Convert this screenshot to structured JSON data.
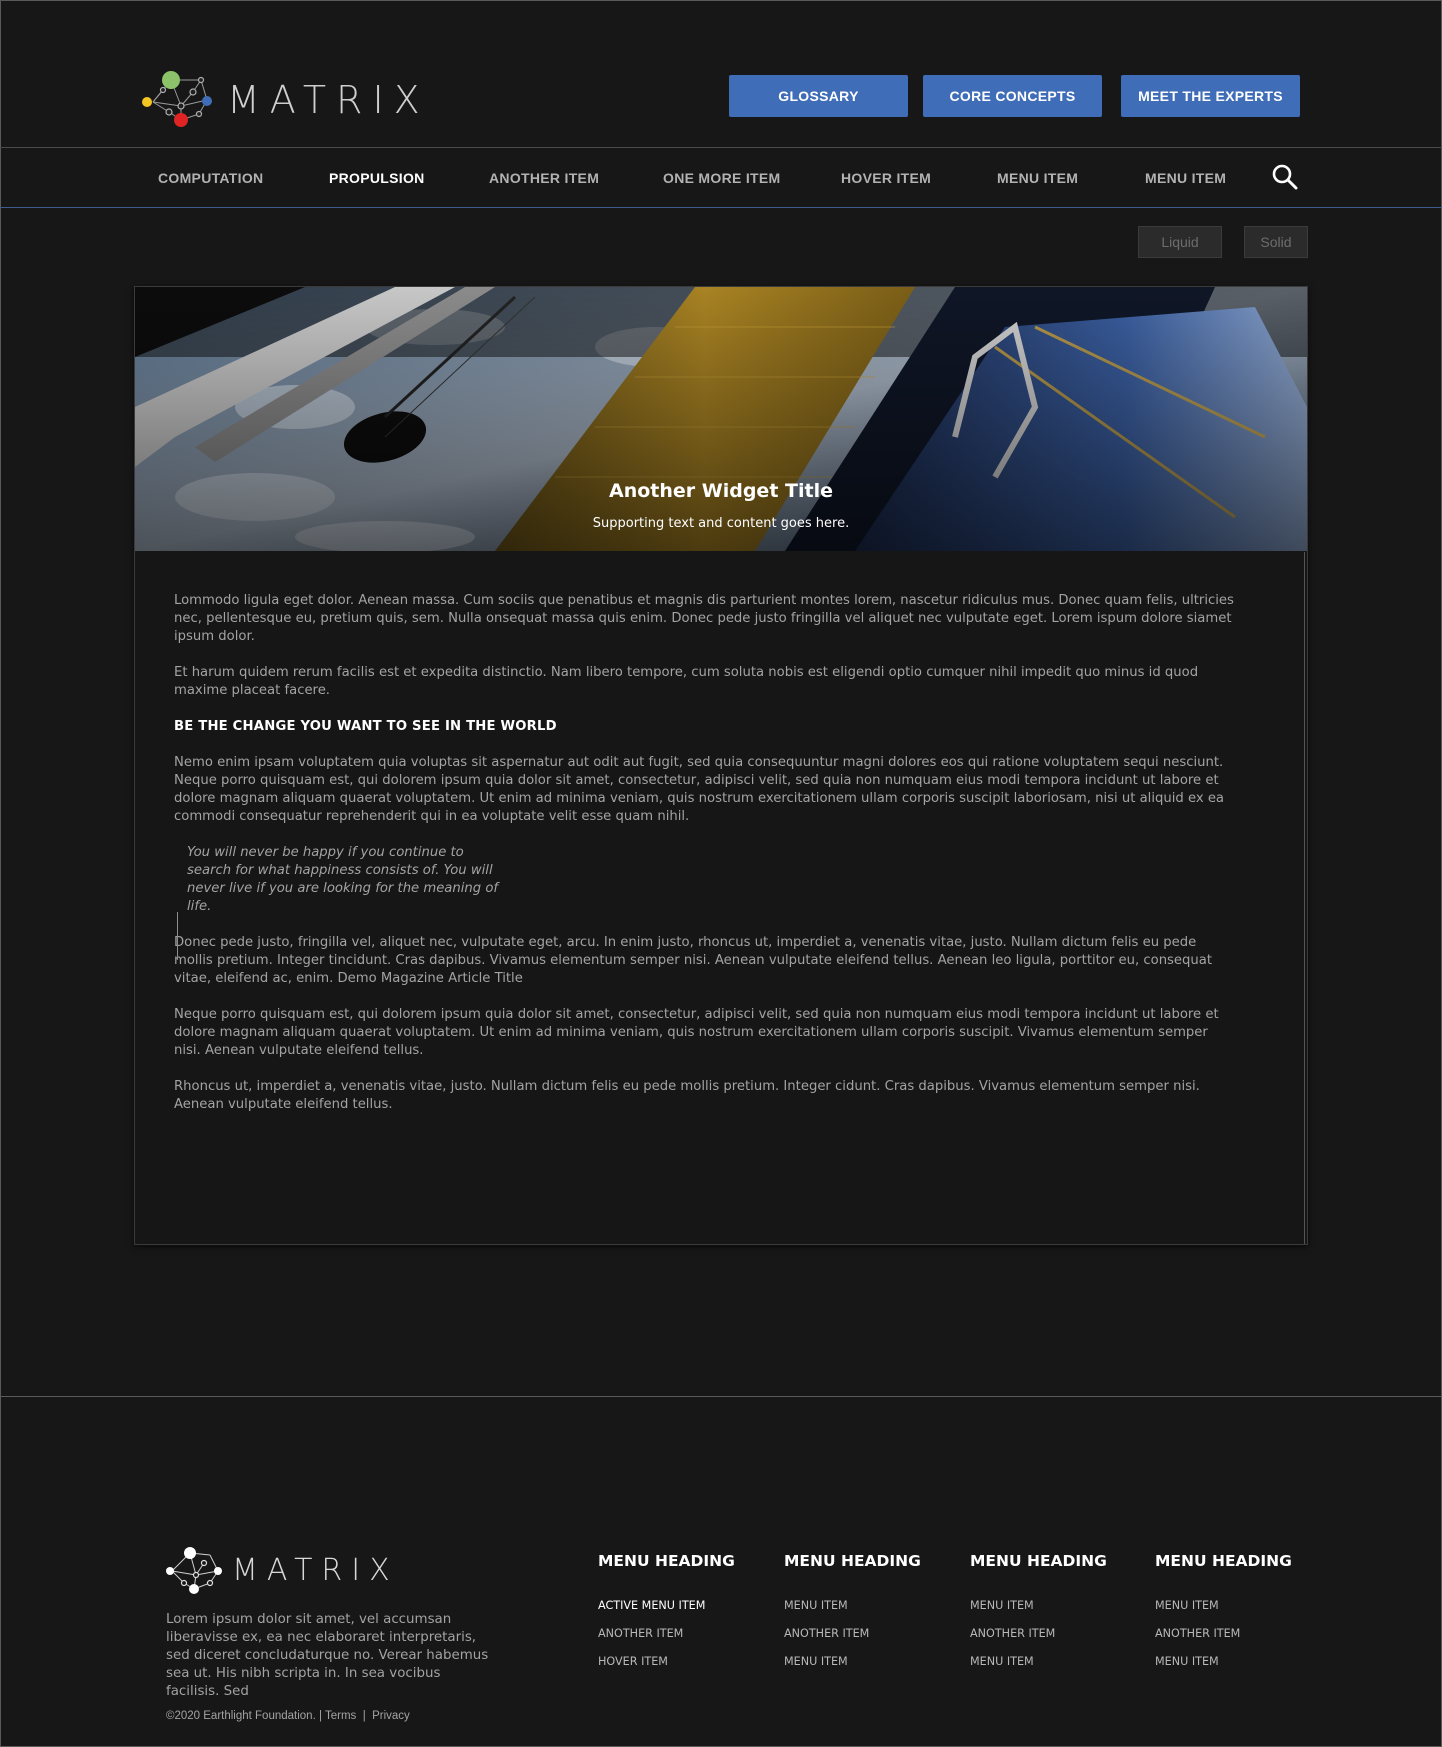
{
  "header": {
    "logo_text": "MATRIX",
    "buttons": [
      "GLOSSARY",
      "CORE CONCEPTS",
      "MEET THE EXPERTS"
    ]
  },
  "nav": {
    "items": [
      "COMPUTATION",
      "PROPULSION",
      "ANOTHER ITEM",
      "ONE MORE ITEM",
      "HOVER ITEM",
      "MENU ITEM",
      "MENU ITEM"
    ],
    "active": "PROPULSION"
  },
  "toggles": [
    "Liquid",
    "Solid"
  ],
  "widget": {
    "title": "Another Widget Title",
    "subtitle": "Supporting text and content goes here."
  },
  "article": {
    "p1": "Lommodo ligula eget dolor. Aenean massa. Cum sociis que penatibus et magnis dis parturient montes lorem, nascetur ridiculus mus. Donec quam felis, ultricies nec, pellentesque eu, pretium quis, sem. Nulla onsequat massa quis enim. Donec pede justo fringilla vel aliquet nec vulputate eget. Lorem ispum dolore siamet ipsum dolor.",
    "p2": "Et harum quidem rerum facilis est et expedita distinctio. Nam libero tempore, cum soluta nobis est eligendi optio cumquer nihil impedit quo minus id quod maxime placeat facere.",
    "heading": "BE THE CHANGE YOU WANT TO SEE IN THE WORLD",
    "p3": "Nemo enim ipsam voluptatem quia voluptas sit aspernatur aut odit aut fugit, sed quia consequuntur magni dolores eos qui ratione voluptatem sequi nesciunt. Neque porro quisquam est, qui dolorem ipsum quia dolor sit amet, consectetur, adipisci velit, sed quia non numquam eius modi tempora incidunt ut labore et dolore magnam aliquam quaerat voluptatem. Ut enim ad minima veniam, quis nostrum exercitationem ullam corporis suscipit laboriosam, nisi ut aliquid ex ea commodi consequatur reprehenderit qui in ea voluptate velit esse quam nihil.",
    "quote": "You will never be happy if you continue to search for what happiness consists of. You will never live if you are looking for the meaning of life.",
    "p4": "Donec pede justo, fringilla vel, aliquet nec, vulputate eget, arcu. In enim justo, rhoncus ut, imperdiet a, venenatis vitae, justo. Nullam dictum felis eu pede mollis pretium. Integer tincidunt. Cras dapibus. Vivamus elementum semper nisi. Aenean vulputate eleifend tellus. Aenean leo ligula, porttitor eu, consequat vitae, eleifend ac, enim. Demo Magazine Article Title",
    "p5": "Neque porro quisquam est, qui dolorem ipsum quia dolor sit amet, consectetur, adipisci velit, sed quia non numquam eius modi tempora incidunt ut labore et dolore magnam aliquam quaerat voluptatem. Ut enim ad minima veniam, quis nostrum exercitationem ullam corporis suscipit. Vivamus elementum semper nisi. Aenean vulputate eleifend tellus.",
    "p6": "Rhoncus ut, imperdiet a, venenatis vitae, justo. Nullam dictum felis eu pede mollis pretium. Integer cidunt. Cras dapibus. Vivamus elementum semper nisi. Aenean vulputate eleifend tellus."
  },
  "footer": {
    "logo_text": "MATRIX",
    "description": "Lorem ipsum dolor sit amet, vel accumsan liberavisse ex, ea nec elaboraret interpretaris, sed diceret concludaturque no. Verear habemus sea ut. His nibh scripta in. In sea vocibus facilisis. Sed",
    "copyright": "©2020 Earthlight Foundation.",
    "sep": "|",
    "terms": "Terms",
    "privacy": "Privacy",
    "columns": [
      {
        "heading": "MENU HEADING",
        "links": [
          "ACTIVE MENU ITEM",
          "ANOTHER ITEM",
          "HOVER ITEM"
        ]
      },
      {
        "heading": "MENU HEADING",
        "links": [
          "MENU ITEM",
          "ANOTHER ITEM",
          "MENU ITEM"
        ]
      },
      {
        "heading": "MENU HEADING",
        "links": [
          "MENU ITEM",
          "ANOTHER ITEM",
          "MENU ITEM"
        ]
      },
      {
        "heading": "MENU HEADING",
        "links": [
          "MENU ITEM",
          "ANOTHER ITEM",
          "MENU ITEM"
        ]
      }
    ]
  },
  "colors": {
    "background": "#171717",
    "accent_button": "#3f6db8",
    "nav_underline": "#3e5b8f"
  }
}
